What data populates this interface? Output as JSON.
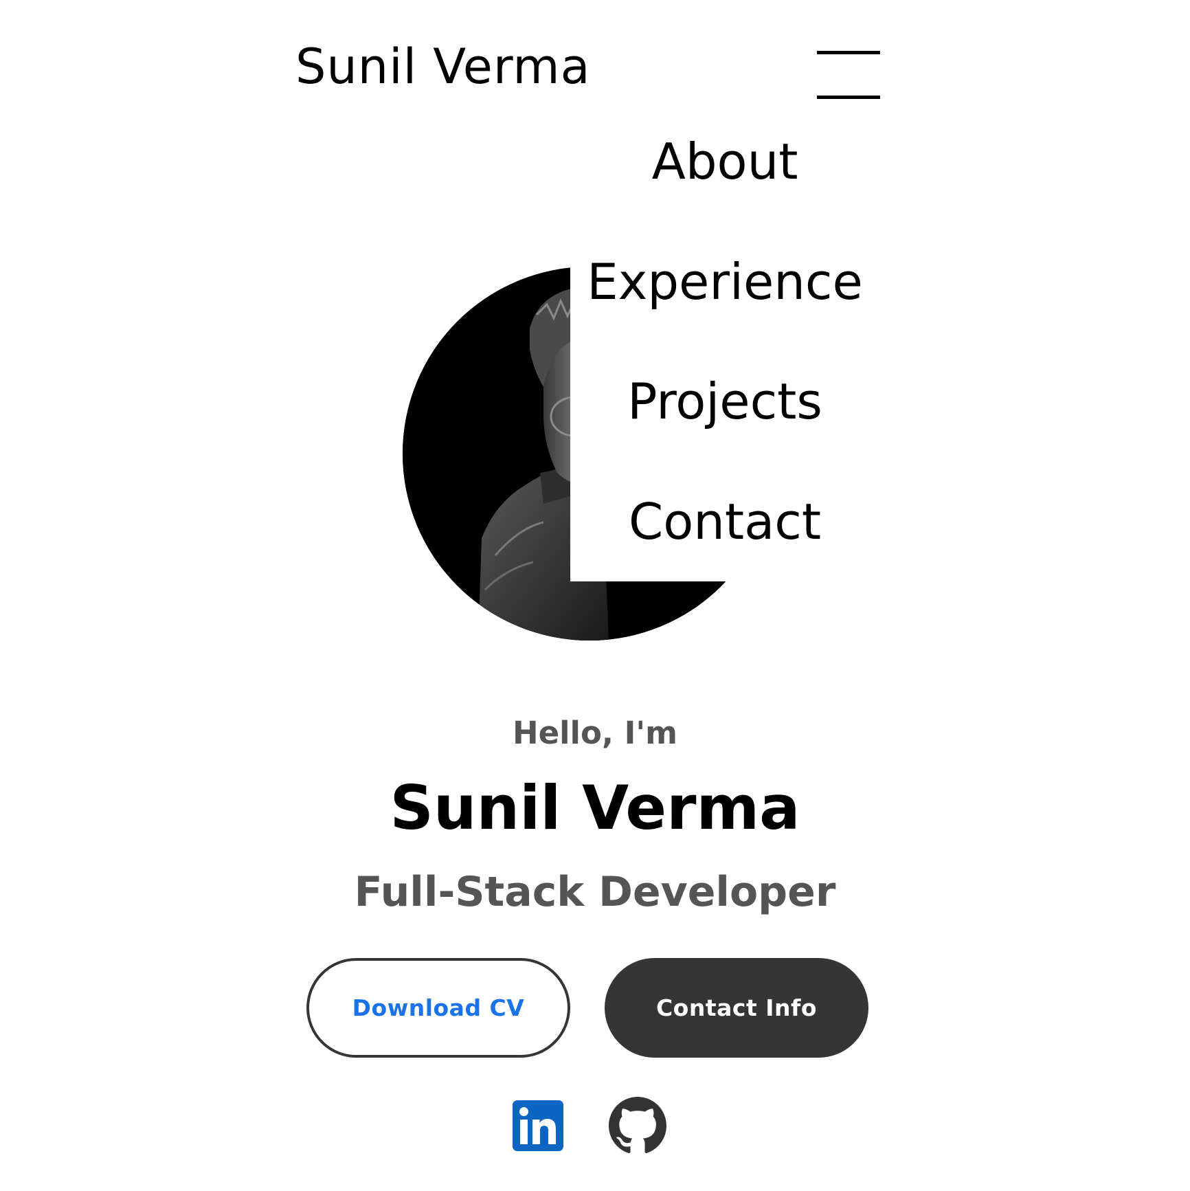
{
  "nav": {
    "logo": "Sunil Verma",
    "menu_icon": "hamburger-menu-icon",
    "menu_items": [
      {
        "label": "About"
      },
      {
        "label": "Experience"
      },
      {
        "label": "Projects"
      },
      {
        "label": "Contact"
      }
    ]
  },
  "profile": {
    "image": "profile-photo"
  },
  "hero": {
    "greeting": "Hello, I'm",
    "name": "Sunil Verma",
    "role": "Full-Stack Developer"
  },
  "buttons": {
    "download_cv": "Download CV",
    "contact_info": "Contact Info"
  },
  "social": {
    "linkedin_icon": "linkedin-icon",
    "github_icon": "github-icon"
  },
  "colors": {
    "accent_blue": "#1a73e8",
    "dark_button": "#353535",
    "muted_text": "#555555",
    "linkedin_blue": "#0a66c2"
  }
}
